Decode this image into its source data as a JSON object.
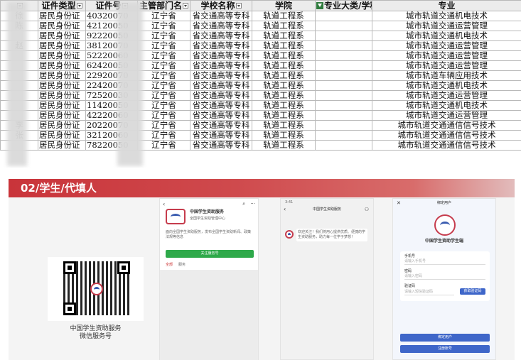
{
  "sheet": {
    "headers": [
      "",
      "证件类型",
      "证件号",
      "主管部门名",
      "学校名称",
      "学院",
      "专业大类/学科",
      "专业"
    ],
    "rows": [
      [
        "徐",
        "居民身份证",
        "40320070",
        "辽宁省",
        "省交通高等专科",
        "轨道工程系",
        "",
        "城市轨道交通机电技术"
      ],
      [
        "陈",
        "居民身份证",
        "42120050",
        "辽宁省",
        "省交通高等专科",
        "轨道工程系",
        "",
        "城市轨道交通运营管理"
      ],
      [
        "",
        "居民身份证",
        "92220050",
        "辽宁省",
        "省交通高等专科",
        "轨道工程系",
        "",
        "城市轨道交通机电技术"
      ],
      [
        "赵",
        "居民身份证",
        "38120070",
        "辽宁省",
        "省交通高等专科",
        "轨道工程系",
        "",
        "城市轨道交通运营管理"
      ],
      [
        "",
        "居民身份证",
        "52220060",
        "辽宁省",
        "省交通高等专科",
        "轨道工程系",
        "",
        "城市轨道交通运营管理"
      ],
      [
        "",
        "居民身份证",
        "62420050",
        "辽宁省",
        "省交通高等专科",
        "轨道工程系",
        "",
        "城市轨道交通运营管理"
      ],
      [
        "",
        "居民身份证",
        "22920070",
        "辽宁省",
        "省交通高等专科",
        "轨道工程系",
        "",
        "城市轨道车辆应用技术"
      ],
      [
        "",
        "居民身份证",
        "22420070",
        "辽宁省",
        "省交通高等专科",
        "轨道工程系",
        "",
        "城市轨道交通机电技术"
      ],
      [
        "",
        "居民身份证",
        "72520030",
        "辽宁省",
        "省交通高等专科",
        "轨道工程系",
        "",
        "城市轨道交通运营管理"
      ],
      [
        "",
        "居民身份证",
        "11420050",
        "辽宁省",
        "省交通高等专科",
        "轨道工程系",
        "",
        "城市轨道交通机电技术"
      ],
      [
        "",
        "居民身份证",
        "42220060",
        "辽宁省",
        "省交通高等专科",
        "轨道工程系",
        "",
        "城市轨道交通运营管理"
      ],
      [
        "李",
        "居民身份证",
        "20220070",
        "辽宁省",
        "省交通高等专科",
        "轨道工程系",
        "",
        "城市轨道交通通信信号技术"
      ],
      [
        "张",
        "居民身份证",
        "32120060",
        "辽宁省",
        "省交通高等专科",
        "轨道工程系",
        "",
        "城市轨道交通通信信号技术"
      ],
      [
        "",
        "居民身份证",
        "78220050",
        "辽宁省",
        "省交通高等专科",
        "轨道工程系",
        "",
        "城市轨道交通通信信号技术"
      ]
    ]
  },
  "slide": {
    "banner_title": "02/学生/代填人",
    "qr_caption_line1": "中国学生资助服务",
    "qr_caption_line2": "微信服务号",
    "phone1": {
      "account_name": "中国学生资助服务",
      "account_org": "全国学生资助管理中心",
      "desc": "面向全国学生资助服务，发布全国学生资助新闻、政策法规等信息",
      "follow_btn": "关注服务号",
      "tab1": "全部",
      "tab2": "服务"
    },
    "phone2": {
      "time": "3:41",
      "title": "中国学生资助服务",
      "msg": "欢迎关注！我们将用心提供优质、便捷的学生资助服务，助力每一位学子梦想！"
    },
    "phone3": {
      "title": "绑定用户",
      "app_name": "中国学生资助学生端",
      "f1_label": "手机号",
      "f1_ph": "请输入手机号",
      "f2_label": "密码",
      "f2_ph": "请输入密码",
      "f3_label": "验证码",
      "f3_ph": "请输入短信验证码",
      "code_btn": "获取验证码",
      "bind_btn": "绑定用户",
      "register_btn": "注册账号"
    }
  },
  "colors": {
    "banner": "#c9343a",
    "filter": "#2f7b3d",
    "button": "#3e66c9",
    "follow": "#2ea94a"
  }
}
